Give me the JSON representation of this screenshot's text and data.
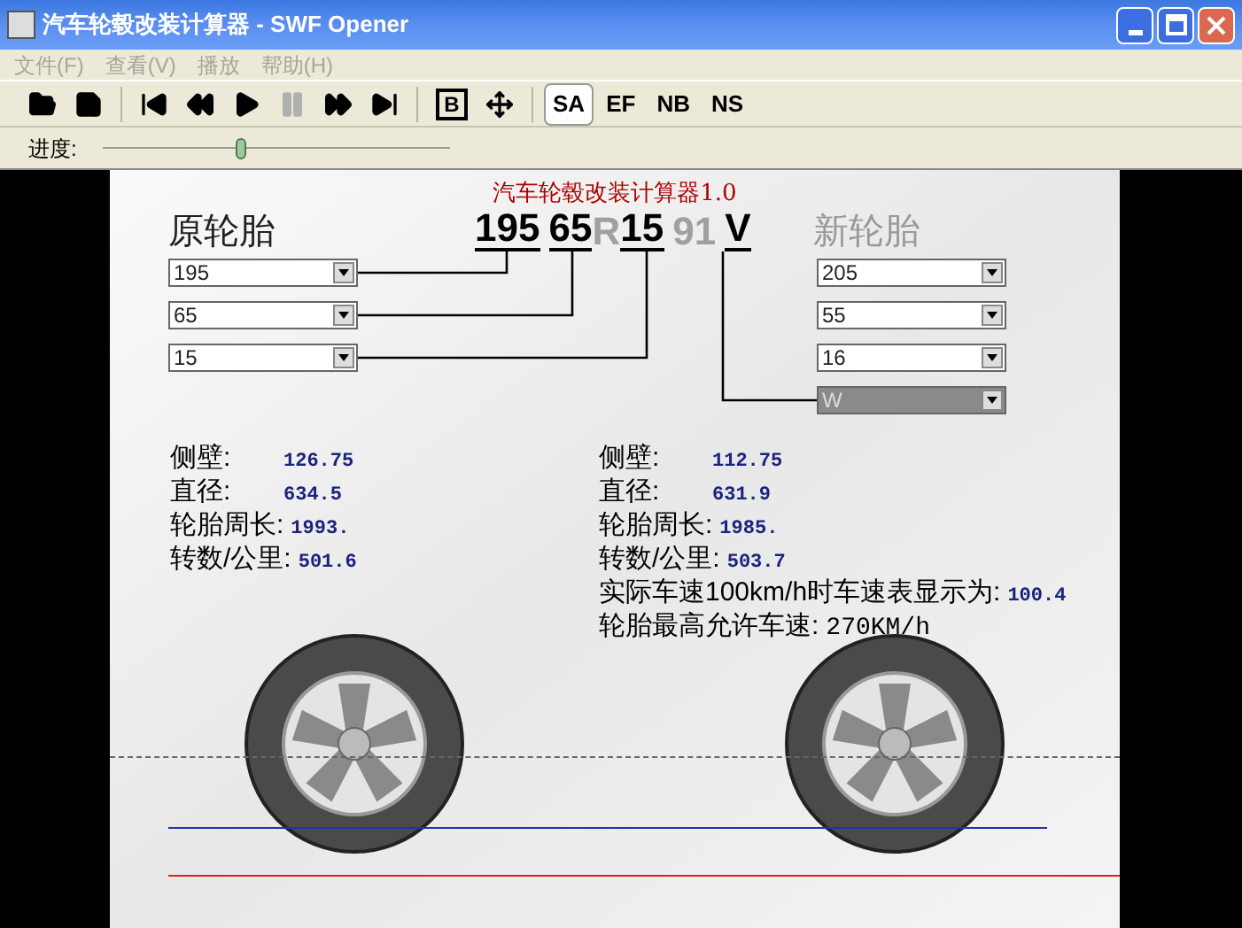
{
  "window": {
    "title": "汽车轮毂改装计算器 - SWF Opener"
  },
  "menu": [
    {
      "label": "文件(F)",
      "disabled": true
    },
    {
      "label": "查看(V)",
      "disabled": true
    },
    {
      "label": "播放",
      "disabled": true
    },
    {
      "label": "帮助(H)",
      "disabled": true
    }
  ],
  "toolbar": [
    {
      "kind": "open",
      "disabled": false
    },
    {
      "kind": "save",
      "disabled": false
    },
    {
      "kind": "sep"
    },
    {
      "kind": "first",
      "disabled": false
    },
    {
      "kind": "rewind",
      "disabled": false
    },
    {
      "kind": "play",
      "disabled": false
    },
    {
      "kind": "pause",
      "disabled": true
    },
    {
      "kind": "forward",
      "disabled": false
    },
    {
      "kind": "last",
      "disabled": false
    },
    {
      "kind": "sep"
    },
    {
      "kind": "boxed",
      "label": "B",
      "disabled": false
    },
    {
      "kind": "move",
      "disabled": false
    },
    {
      "kind": "sep"
    },
    {
      "kind": "text",
      "label": "SA",
      "selected": true
    },
    {
      "kind": "text",
      "label": "EF",
      "selected": false
    },
    {
      "kind": "text",
      "label": "NB",
      "selected": false
    },
    {
      "kind": "text",
      "label": "NS",
      "selected": false
    }
  ],
  "progress": {
    "label": "进度:",
    "level": 0.4
  },
  "calculator": {
    "title": "汽车轮毂改装计算器1.0",
    "original": {
      "heading": "原轮胎",
      "dropdowns": [
        {
          "value": "195",
          "disabled": false
        },
        {
          "value": "65",
          "disabled": false
        },
        {
          "value": "15",
          "disabled": false
        }
      ]
    },
    "tire_code": [
      {
        "text": "195",
        "dim": false
      },
      {
        "text": "65",
        "dim": false
      },
      {
        "text": "R",
        "dim": true
      },
      {
        "text": "15",
        "dim": false
      },
      {
        "text": "91",
        "dim": true
      },
      {
        "text": "V",
        "dim": false
      }
    ],
    "new": {
      "heading": "新轮胎",
      "dropdowns": [
        {
          "value": "205",
          "disabled": false
        },
        {
          "value": "55",
          "disabled": false
        },
        {
          "value": "16",
          "disabled": false
        },
        {
          "value": "W",
          "disabled": true
        }
      ]
    },
    "original_stats": [
      {
        "label": "侧壁:",
        "value": "126.75"
      },
      {
        "label": "直径:",
        "value": "634.5"
      },
      {
        "label": "轮胎周长:",
        "value": "1993."
      },
      {
        "label": "转数/公里:",
        "value": "501.6"
      }
    ],
    "new_stats": [
      {
        "label": "侧壁:",
        "value": "112.75"
      },
      {
        "label": "直径:",
        "value": "631.9"
      },
      {
        "label": "轮胎周长:",
        "value": "1985."
      },
      {
        "label": "转数/公里:",
        "value": "503.7"
      },
      {
        "label": "实际车速100km/h时车速表显示为:",
        "value": "100.4"
      },
      {
        "label": "轮胎最高允许车速:",
        "value": "270KM/h",
        "plain": true
      }
    ]
  }
}
